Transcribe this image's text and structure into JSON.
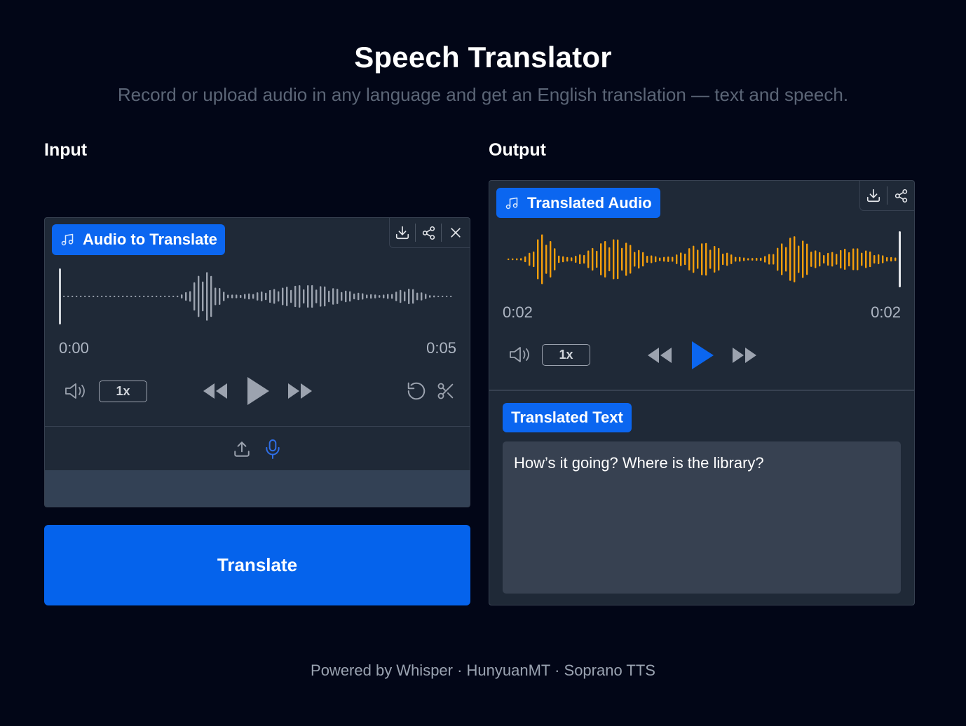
{
  "header": {
    "title": "Speech Translator",
    "subtitle": "Record or upload audio in any language and get an English translation — text and speech."
  },
  "input": {
    "section_label": "Input",
    "audio_label": "Audio to Translate",
    "time_current": "0:00",
    "time_total": "0:05",
    "speed": "1x",
    "waveform_color": "#9ca3af",
    "source_icons": [
      "upload-icon",
      "microphone-icon"
    ]
  },
  "translate_button": "Translate",
  "output": {
    "section_label": "Output",
    "audio_label": "Translated Audio",
    "time_current": "0:02",
    "time_total": "0:02",
    "speed": "1x",
    "waveform_color": "#f59e0b",
    "text_label": "Translated Text",
    "text_value": "How’s it going? Where is the library?"
  },
  "footer": "Powered by Whisper · HunyuanMT · Soprano TTS",
  "colors": {
    "background": "#020617",
    "panel": "#1f2937",
    "accent": "#0b66f0",
    "waveform_output": "#f59e0b",
    "waveform_input": "#9ca3af"
  }
}
